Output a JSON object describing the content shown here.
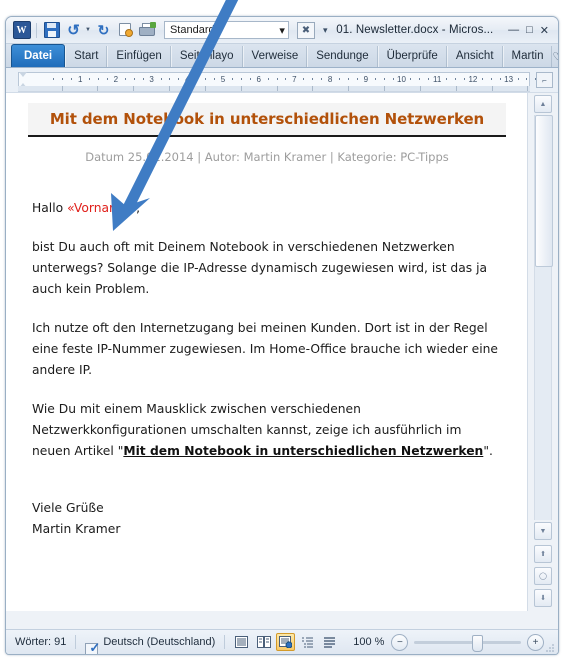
{
  "window": {
    "doc_title": "01. Newsletter.docx - Micros...",
    "minimize_label": "—",
    "maximize_label": "□",
    "close_label": "✕"
  },
  "quick_access": {
    "app_logo": "W",
    "items": [
      {
        "name": "save-icon",
        "label": "Speichern"
      },
      {
        "name": "undo-icon",
        "label": "Rückgängig"
      },
      {
        "name": "redo-icon",
        "label": "Wiederholen"
      },
      {
        "name": "print-preview-icon",
        "label": "Seitenansicht"
      },
      {
        "name": "quick-print-icon",
        "label": "Schnelldruck"
      }
    ],
    "style_box_value": "Standard",
    "style_box_caret": "▾",
    "excel_icon": "X",
    "customize_caret": "▾"
  },
  "ribbon": {
    "tabs": [
      {
        "label": "Datei",
        "active": true
      },
      {
        "label": "Start",
        "active": false
      },
      {
        "label": "Einfügen",
        "active": false
      },
      {
        "label": "Seitenlayo",
        "active": false
      },
      {
        "label": "Verweise",
        "active": false
      },
      {
        "label": "Sendunge",
        "active": false
      },
      {
        "label": "Überprüfe",
        "active": false
      },
      {
        "label": "Ansicht",
        "active": false
      },
      {
        "label": "Martin",
        "active": false
      }
    ],
    "collapse_icon": "♡",
    "help_icon": "?"
  },
  "ruler": {
    "numbers": [
      "1",
      "2",
      "3",
      "4",
      "5",
      "6",
      "7",
      "8",
      "9",
      "10",
      "11",
      "12",
      "13"
    ],
    "tab_stop_button": "⌐"
  },
  "document": {
    "heading": "Mit dem Notebook in unterschiedlichen Netzwerken",
    "meta": "Datum 25.01.2014 | Autor: Martin Kramer | Kategorie: PC-Tipps",
    "salutation_prefix": "Hallo ",
    "merge_field": "«Vorname»",
    "salutation_suffix": ",",
    "paragraph_1": "bist Du auch oft mit Deinem Notebook in verschiedenen Netzwerken unterwegs? Solange die IP-Adresse dynamisch zugewiesen wird, ist das ja auch kein Problem.",
    "paragraph_2": "Ich nutze oft den Internetzugang bei meinen Kunden. Dort ist in der Regel eine feste IP-Nummer zugewiesen. Im Home-Office brauche ich wieder eine andere IP.",
    "paragraph_3_before": "Wie Du mit einem Mausklick zwischen verschiedenen Netzwerkkonfigurationen umschalten kannst, zeige ich ausführlich im neuen Artikel \"",
    "paragraph_3_link": "Mit dem Notebook in unterschiedlichen Netzwerken",
    "paragraph_3_after": "\".",
    "closing_line_1": "Viele Grüße",
    "closing_line_2": "Martin Kramer"
  },
  "scrollbar": {
    "up_arrow": "▲",
    "down_arrow": "▼",
    "prev_page_icon": "⬆",
    "browse_object_icon": "◯",
    "next_page_icon": "⬇"
  },
  "status_bar": {
    "word_count": "Wörter: 91",
    "spell_check_name": "spell-check-icon",
    "language": "Deutsch (Deutschland)",
    "view_modes": [
      {
        "name": "print-layout-icon",
        "active": false
      },
      {
        "name": "full-screen-reading-icon",
        "active": false
      },
      {
        "name": "web-layout-icon",
        "active": true
      },
      {
        "name": "outline-icon",
        "active": false
      },
      {
        "name": "draft-icon",
        "active": false
      }
    ],
    "zoom_level": "100 %",
    "zoom_out_label": "−",
    "zoom_in_label": "+"
  },
  "annotation": {
    "arrow_name": "pointer-arrow",
    "color": "#3f7cc4"
  },
  "colors": {
    "heading": "#b2510a",
    "merge_field": "#e0201b",
    "tab_active_bg": "#1f6cba",
    "view_active_bg": "#f8c96a"
  }
}
